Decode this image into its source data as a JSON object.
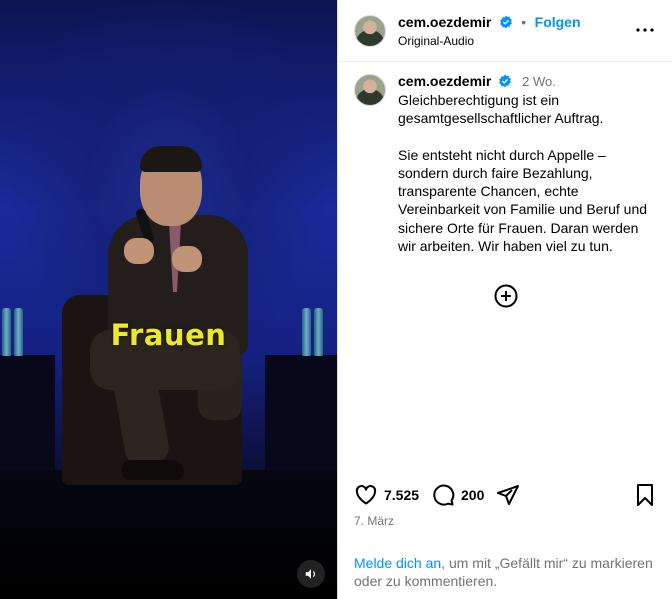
{
  "video": {
    "caption_overlay": "Frauen",
    "sound_icon": "speaker-icon"
  },
  "header": {
    "username": "cem.oezdemir",
    "separator": "•",
    "follow_label": "Folgen",
    "audio_label": "Original-Audio",
    "more_icon": "more-horizontal-icon"
  },
  "post": {
    "username": "cem.oezdemir",
    "time_ago": "2 Wo.",
    "caption": "Gleichberechtigung ist ein gesamtgesellschaftlicher Auftrag.\n\nSie entsteht nicht durch Appelle – sondern durch faire Bezahlung, transparente Chancen, echte Vereinbarkeit von Familie und Beruf und sichere Orte für Frauen. Daran werden wir arbeiten. Wir haben viel zu tun."
  },
  "actions": {
    "likes": "7.525",
    "comments": "200",
    "date": "7. März"
  },
  "login_prompt": {
    "link": "Melde dich an",
    "text": ", um mit „Gefällt mir“ zu markieren oder zu kommentieren."
  },
  "colors": {
    "accent": "#0095f6",
    "caption_yellow": "#ece82a",
    "muted": "#737373"
  }
}
